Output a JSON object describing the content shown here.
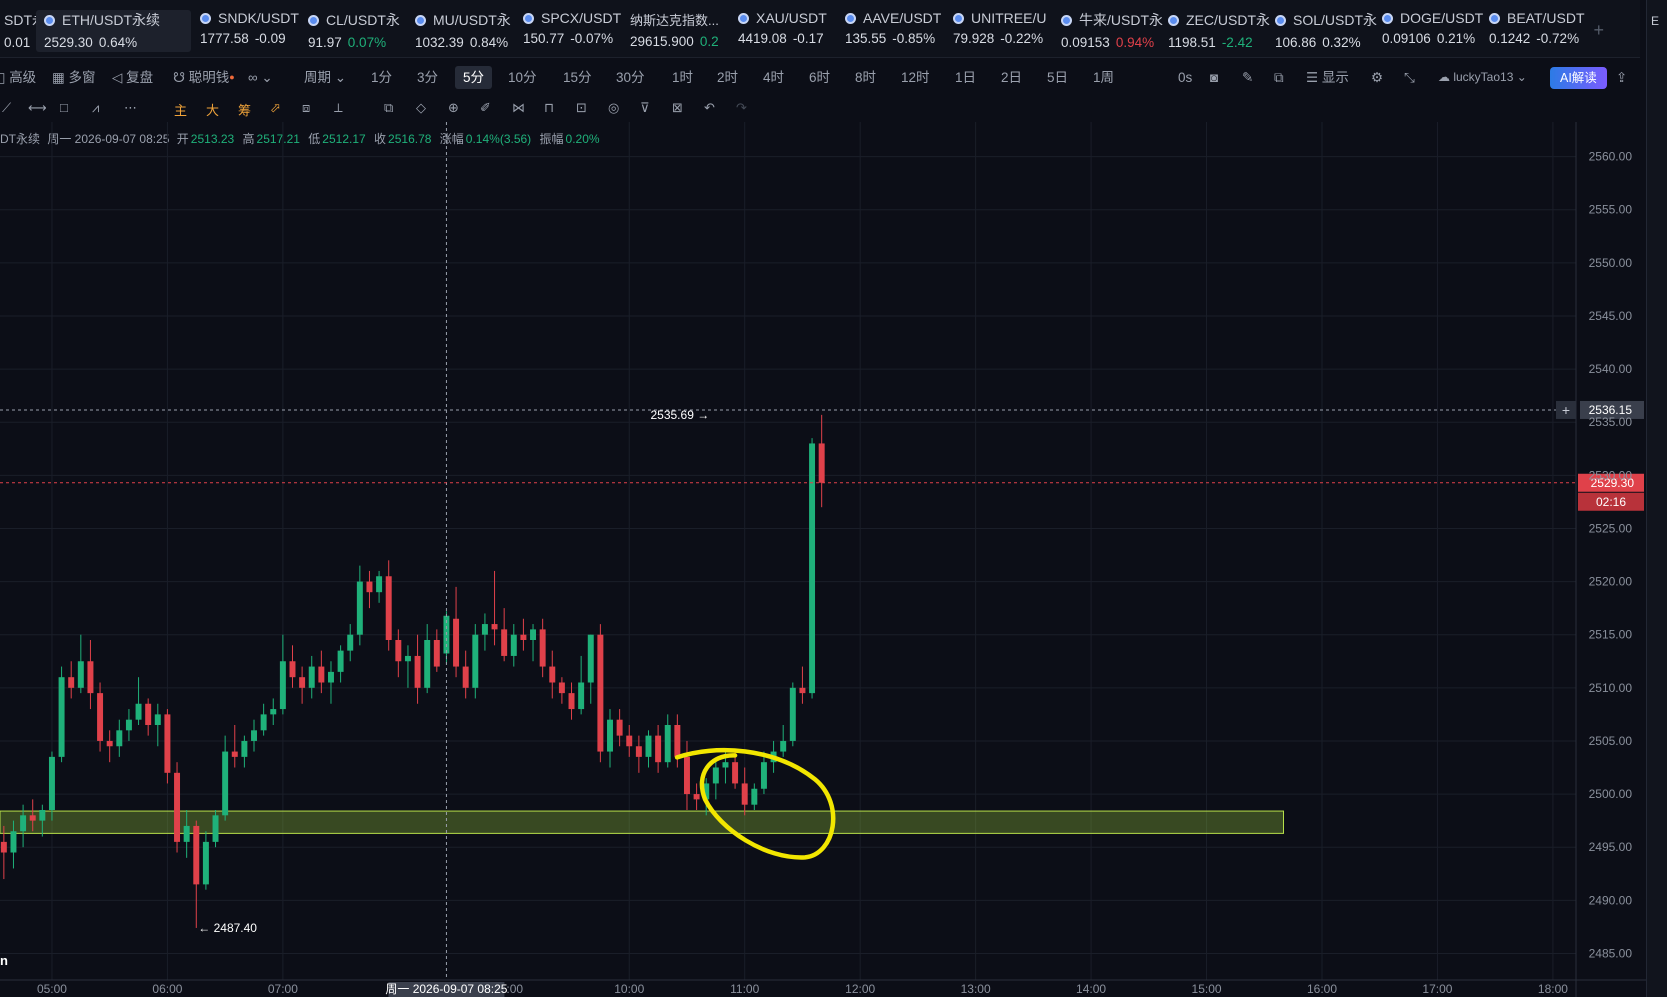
{
  "tickers": [
    {
      "name": "SDT永",
      "price": "0.01",
      "change": "",
      "dir": "up"
    },
    {
      "name": "ETH/USDT永续",
      "price": "2529.30",
      "change": "0.64%",
      "dir": "active"
    },
    {
      "name": "SNDK/USDT",
      "price": "1777.58",
      "change": "-0.09",
      "dir": "up"
    },
    {
      "name": "CL/USDT永",
      "price": "91.97",
      "change": "0.07%",
      "dir": "up"
    },
    {
      "name": "MU/USDT永",
      "price": "1032.39",
      "change": "0.84%",
      "dir": "up"
    },
    {
      "name": "SPCX/USDT",
      "price": "150.77",
      "change": "-0.07%",
      "dir": "up"
    },
    {
      "name": "纳斯达克指数...",
      "price": "29615.900",
      "change": "0.2",
      "dir": "up"
    },
    {
      "name": "XAU/USDT",
      "price": "4419.08",
      "change": "-0.17",
      "dir": "up"
    },
    {
      "name": "AAVE/USDT",
      "price": "135.55",
      "change": "-0.85%",
      "dir": "up"
    },
    {
      "name": "UNITREE/U",
      "price": "79.928",
      "change": "-0.22%",
      "dir": "up"
    },
    {
      "name": "牛来/USDT永",
      "price": "0.09153",
      "change": "0.94%",
      "dir": "down"
    },
    {
      "name": "ZEC/USDT永",
      "price": "1198.51",
      "change": "-2.42",
      "dir": "up"
    },
    {
      "name": "SOL/USDT永",
      "price": "106.86",
      "change": "0.32%",
      "dir": "up"
    },
    {
      "name": "DOGE/USDT",
      "price": "0.09106",
      "change": "0.21%",
      "dir": "up"
    },
    {
      "name": "BEAT/USDT",
      "price": "0.1242",
      "change": "-0.72%",
      "dir": "up"
    }
  ],
  "toolbar": {
    "left": [
      "高级",
      "多窗",
      "复盘",
      "聪明钱"
    ],
    "period_label": "周期",
    "periods": [
      "1分",
      "3分",
      "5分",
      "10分",
      "15分",
      "30分",
      "1时",
      "2时",
      "4时",
      "6时",
      "8时",
      "12时",
      "1日",
      "2日",
      "5日",
      "1周"
    ],
    "selected_period": "5分",
    "countdown_label": "0s",
    "display_label": "显示",
    "username": "luckyTao13",
    "ai_label": "AI解读"
  },
  "draw_tools": {
    "labels": [
      "主",
      "大",
      "筹"
    ]
  },
  "ohlc": {
    "symbol": "DT永续",
    "date": "周一 2026-09-07 08:25",
    "open_label": "开",
    "open": "2513.23",
    "high_label": "高",
    "high": "2517.21",
    "low_label": "低",
    "low": "2512.17",
    "close_label": "收",
    "close": "2516.78",
    "change_label": "涨幅",
    "change": "0.14%(3.56)",
    "amp_label": "振幅",
    "amp": "0.20%"
  },
  "chart_data": {
    "type": "candlestick",
    "interval": "5分",
    "ylim": [
      2482.5,
      2562.5
    ],
    "y_ticks": [
      2485,
      2490,
      2495,
      2500,
      2505,
      2510,
      2515,
      2520,
      2525,
      2530,
      2535,
      2540,
      2545,
      2550,
      2555,
      2560
    ],
    "x_ticks": [
      {
        "label": "05:00",
        "t": 0
      },
      {
        "label": "06:00",
        "t": 60
      },
      {
        "label": "07:00",
        "t": 120
      },
      {
        "label": "10:00",
        "t": 300
      },
      {
        "label": "11:00",
        "t": 360
      },
      {
        "label": "12:00",
        "t": 420
      },
      {
        "label": "13:00",
        "t": 480
      },
      {
        "label": "14:00",
        "t": 540
      },
      {
        "label": "15:00",
        "t": 600
      },
      {
        "label": "16:00",
        "t": 660
      },
      {
        "label": "17:00",
        "t": 720
      },
      {
        "label": "18:00",
        "t": 780
      }
    ],
    "x_range": [
      -27,
      792
    ],
    "crosshair": {
      "t": 205,
      "price": 2536.15,
      "label": "周一 2026-09-07 08:25",
      "tail": ":00"
    },
    "last_price": {
      "price": 2529.3,
      "label": "2529.30",
      "countdown": "02:16"
    },
    "high_marker": {
      "price": 2535.69,
      "t": 340,
      "label": "2535.69 →"
    },
    "low_marker": {
      "price": 2487.4,
      "t": 75,
      "label": "← 2487.40"
    },
    "zone": {
      "t_start": -27,
      "t_end": 640,
      "low": 2496.3,
      "high": 2498.4
    },
    "candles": [
      {
        "t": -25,
        "o": 2495.5,
        "h": 2497.0,
        "l": 2492.0,
        "c": 2494.5
      },
      {
        "t": -20,
        "o": 2494.5,
        "h": 2497.5,
        "l": 2493.0,
        "c": 2496.5
      },
      {
        "t": -15,
        "o": 2496.5,
        "h": 2499.0,
        "l": 2495.0,
        "c": 2498.0
      },
      {
        "t": -10,
        "o": 2498.0,
        "h": 2499.5,
        "l": 2496.5,
        "c": 2497.5
      },
      {
        "t": -5,
        "o": 2497.5,
        "h": 2499.0,
        "l": 2496.0,
        "c": 2498.5
      },
      {
        "t": 0,
        "o": 2498.5,
        "h": 2504.0,
        "l": 2497.5,
        "c": 2503.5
      },
      {
        "t": 5,
        "o": 2503.5,
        "h": 2512.0,
        "l": 2503.0,
        "c": 2511.0
      },
      {
        "t": 10,
        "o": 2511.0,
        "h": 2512.5,
        "l": 2509.0,
        "c": 2510.0
      },
      {
        "t": 15,
        "o": 2510.0,
        "h": 2515.0,
        "l": 2509.5,
        "c": 2512.5
      },
      {
        "t": 20,
        "o": 2512.5,
        "h": 2514.5,
        "l": 2508.0,
        "c": 2509.5
      },
      {
        "t": 25,
        "o": 2509.5,
        "h": 2510.5,
        "l": 2504.0,
        "c": 2505.0
      },
      {
        "t": 30,
        "o": 2505.0,
        "h": 2506.0,
        "l": 2503.0,
        "c": 2504.5
      },
      {
        "t": 35,
        "o": 2504.5,
        "h": 2507.0,
        "l": 2503.5,
        "c": 2506.0
      },
      {
        "t": 40,
        "o": 2506.0,
        "h": 2508.0,
        "l": 2505.0,
        "c": 2507.0
      },
      {
        "t": 45,
        "o": 2507.0,
        "h": 2511.0,
        "l": 2506.5,
        "c": 2508.5
      },
      {
        "t": 50,
        "o": 2508.5,
        "h": 2509.0,
        "l": 2505.5,
        "c": 2506.5
      },
      {
        "t": 55,
        "o": 2506.5,
        "h": 2508.5,
        "l": 2504.5,
        "c": 2507.5
      },
      {
        "t": 60,
        "o": 2507.5,
        "h": 2508.0,
        "l": 2501.0,
        "c": 2502.0
      },
      {
        "t": 65,
        "o": 2502.0,
        "h": 2503.0,
        "l": 2494.5,
        "c": 2495.5
      },
      {
        "t": 70,
        "o": 2495.5,
        "h": 2498.5,
        "l": 2494.0,
        "c": 2497.0
      },
      {
        "t": 75,
        "o": 2497.0,
        "h": 2497.5,
        "l": 2487.4,
        "c": 2491.5
      },
      {
        "t": 80,
        "o": 2491.5,
        "h": 2496.5,
        "l": 2491.0,
        "c": 2495.5
      },
      {
        "t": 85,
        "o": 2495.5,
        "h": 2498.5,
        "l": 2495.0,
        "c": 2498.0
      },
      {
        "t": 90,
        "o": 2498.0,
        "h": 2505.5,
        "l": 2497.5,
        "c": 2504.0
      },
      {
        "t": 95,
        "o": 2504.0,
        "h": 2506.5,
        "l": 2502.5,
        "c": 2503.5
      },
      {
        "t": 100,
        "o": 2503.5,
        "h": 2505.5,
        "l": 2502.5,
        "c": 2505.0
      },
      {
        "t": 105,
        "o": 2505.0,
        "h": 2507.0,
        "l": 2504.0,
        "c": 2506.0
      },
      {
        "t": 110,
        "o": 2506.0,
        "h": 2508.5,
        "l": 2505.5,
        "c": 2507.5
      },
      {
        "t": 115,
        "o": 2507.5,
        "h": 2509.0,
        "l": 2506.5,
        "c": 2508.0
      },
      {
        "t": 120,
        "o": 2508.0,
        "h": 2515.0,
        "l": 2507.5,
        "c": 2512.5
      },
      {
        "t": 125,
        "o": 2512.5,
        "h": 2514.0,
        "l": 2510.0,
        "c": 2511.0
      },
      {
        "t": 130,
        "o": 2511.0,
        "h": 2512.0,
        "l": 2508.5,
        "c": 2510.0
      },
      {
        "t": 135,
        "o": 2510.0,
        "h": 2513.0,
        "l": 2509.0,
        "c": 2512.0
      },
      {
        "t": 140,
        "o": 2512.0,
        "h": 2513.5,
        "l": 2509.5,
        "c": 2510.5
      },
      {
        "t": 145,
        "o": 2510.5,
        "h": 2512.5,
        "l": 2508.5,
        "c": 2511.5
      },
      {
        "t": 150,
        "o": 2511.5,
        "h": 2514.0,
        "l": 2510.5,
        "c": 2513.5
      },
      {
        "t": 155,
        "o": 2513.5,
        "h": 2516.0,
        "l": 2512.5,
        "c": 2515.0
      },
      {
        "t": 160,
        "o": 2515.0,
        "h": 2521.5,
        "l": 2514.0,
        "c": 2520.0
      },
      {
        "t": 165,
        "o": 2520.0,
        "h": 2521.0,
        "l": 2517.5,
        "c": 2519.0
      },
      {
        "t": 170,
        "o": 2519.0,
        "h": 2521.0,
        "l": 2518.0,
        "c": 2520.5
      },
      {
        "t": 175,
        "o": 2520.5,
        "h": 2522.0,
        "l": 2513.5,
        "c": 2514.5
      },
      {
        "t": 180,
        "o": 2514.5,
        "h": 2515.5,
        "l": 2511.0,
        "c": 2512.5
      },
      {
        "t": 185,
        "o": 2512.5,
        "h": 2514.0,
        "l": 2510.0,
        "c": 2513.0
      },
      {
        "t": 190,
        "o": 2513.0,
        "h": 2515.0,
        "l": 2508.5,
        "c": 2510.0
      },
      {
        "t": 195,
        "o": 2510.0,
        "h": 2516.0,
        "l": 2509.5,
        "c": 2514.5
      },
      {
        "t": 200,
        "o": 2514.5,
        "h": 2515.5,
        "l": 2511.5,
        "c": 2512.0
      },
      {
        "t": 205,
        "o": 2513.23,
        "h": 2517.21,
        "l": 2512.17,
        "c": 2516.78
      },
      {
        "t": 210,
        "o": 2516.5,
        "h": 2519.5,
        "l": 2511.0,
        "c": 2512.0
      },
      {
        "t": 215,
        "o": 2512.0,
        "h": 2513.5,
        "l": 2509.0,
        "c": 2510.0
      },
      {
        "t": 220,
        "o": 2510.0,
        "h": 2516.0,
        "l": 2509.0,
        "c": 2515.0
      },
      {
        "t": 225,
        "o": 2515.0,
        "h": 2517.0,
        "l": 2513.5,
        "c": 2516.0
      },
      {
        "t": 230,
        "o": 2516.0,
        "h": 2521.0,
        "l": 2514.0,
        "c": 2515.5
      },
      {
        "t": 235,
        "o": 2515.5,
        "h": 2517.5,
        "l": 2512.5,
        "c": 2513.0
      },
      {
        "t": 240,
        "o": 2513.0,
        "h": 2516.0,
        "l": 2512.0,
        "c": 2515.0
      },
      {
        "t": 245,
        "o": 2515.0,
        "h": 2516.5,
        "l": 2513.5,
        "c": 2514.5
      },
      {
        "t": 250,
        "o": 2514.5,
        "h": 2516.0,
        "l": 2512.5,
        "c": 2515.5
      },
      {
        "t": 255,
        "o": 2515.5,
        "h": 2516.5,
        "l": 2511.0,
        "c": 2512.0
      },
      {
        "t": 260,
        "o": 2512.0,
        "h": 2513.5,
        "l": 2509.0,
        "c": 2510.5
      },
      {
        "t": 265,
        "o": 2510.5,
        "h": 2511.0,
        "l": 2508.5,
        "c": 2509.5
      },
      {
        "t": 270,
        "o": 2509.5,
        "h": 2510.5,
        "l": 2507.0,
        "c": 2508.0
      },
      {
        "t": 275,
        "o": 2508.0,
        "h": 2513.0,
        "l": 2507.5,
        "c": 2510.5
      },
      {
        "t": 280,
        "o": 2510.5,
        "h": 2515.0,
        "l": 2508.5,
        "c": 2515.0
      },
      {
        "t": 285,
        "o": 2515.0,
        "h": 2516.0,
        "l": 2503.0,
        "c": 2504.0
      },
      {
        "t": 290,
        "o": 2504.0,
        "h": 2508.0,
        "l": 2502.5,
        "c": 2507.0
      },
      {
        "t": 295,
        "o": 2507.0,
        "h": 2508.0,
        "l": 2504.5,
        "c": 2505.5
      },
      {
        "t": 300,
        "o": 2505.5,
        "h": 2506.5,
        "l": 2503.5,
        "c": 2504.5
      },
      {
        "t": 305,
        "o": 2504.5,
        "h": 2505.5,
        "l": 2502.0,
        "c": 2503.5
      },
      {
        "t": 310,
        "o": 2503.5,
        "h": 2506.0,
        "l": 2502.5,
        "c": 2505.5
      },
      {
        "t": 315,
        "o": 2505.5,
        "h": 2506.5,
        "l": 2502.0,
        "c": 2503.0
      },
      {
        "t": 320,
        "o": 2503.0,
        "h": 2507.5,
        "l": 2502.5,
        "c": 2506.5
      },
      {
        "t": 325,
        "o": 2506.5,
        "h": 2507.5,
        "l": 2502.5,
        "c": 2503.5
      },
      {
        "t": 330,
        "o": 2503.5,
        "h": 2505.0,
        "l": 2498.5,
        "c": 2500.0
      },
      {
        "t": 335,
        "o": 2500.0,
        "h": 2501.0,
        "l": 2498.5,
        "c": 2499.5
      },
      {
        "t": 340,
        "o": 2499.5,
        "h": 2501.5,
        "l": 2498.0,
        "c": 2501.0
      },
      {
        "t": 345,
        "o": 2501.0,
        "h": 2503.0,
        "l": 2499.5,
        "c": 2502.5
      },
      {
        "t": 350,
        "o": 2502.5,
        "h": 2504.0,
        "l": 2501.0,
        "c": 2503.0
      },
      {
        "t": 355,
        "o": 2503.0,
        "h": 2504.0,
        "l": 2500.5,
        "c": 2501.0
      },
      {
        "t": 360,
        "o": 2501.0,
        "h": 2502.5,
        "l": 2498.0,
        "c": 2499.0
      },
      {
        "t": 365,
        "o": 2499.0,
        "h": 2501.0,
        "l": 2498.5,
        "c": 2500.5
      },
      {
        "t": 370,
        "o": 2500.5,
        "h": 2504.0,
        "l": 2500.0,
        "c": 2503.0
      },
      {
        "t": 375,
        "o": 2503.0,
        "h": 2505.0,
        "l": 2502.0,
        "c": 2504.0
      },
      {
        "t": 380,
        "o": 2504.0,
        "h": 2506.5,
        "l": 2503.5,
        "c": 2505.0
      },
      {
        "t": 385,
        "o": 2505.0,
        "h": 2510.5,
        "l": 2504.5,
        "c": 2510.0
      },
      {
        "t": 390,
        "o": 2510.0,
        "h": 2512.0,
        "l": 2508.5,
        "c": 2509.5
      },
      {
        "t": 395,
        "o": 2509.5,
        "h": 2533.5,
        "l": 2509.0,
        "c": 2533.0
      },
      {
        "t": 400,
        "o": 2533.0,
        "h": 2535.69,
        "l": 2527.0,
        "c": 2529.3
      }
    ]
  }
}
